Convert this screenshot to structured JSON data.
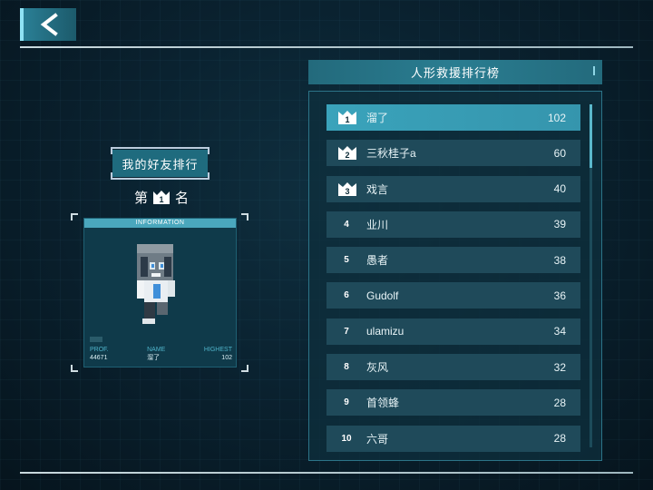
{
  "header": {
    "back_icon": "chevron-left-icon"
  },
  "friends": {
    "title": "我的好友排行",
    "rank_prefix": "第",
    "rank_value": "1",
    "rank_suffix": "名",
    "card": {
      "header": "INFORMATION",
      "prof_label": "PROF.",
      "prof_value": "44671",
      "name_label": "NAME",
      "name_value": "溜了",
      "highest_label": "HIGHEST",
      "highest_value": "102"
    }
  },
  "leaderboard": {
    "title": "人形救援排行榜",
    "rows": [
      {
        "rank": "1",
        "name": "溜了",
        "score": "102",
        "crown": true
      },
      {
        "rank": "2",
        "name": "三秋桂子a",
        "score": "60",
        "crown": true
      },
      {
        "rank": "3",
        "name": "戏言",
        "score": "40",
        "crown": true
      },
      {
        "rank": "4",
        "name": "业川",
        "score": "39",
        "crown": false
      },
      {
        "rank": "5",
        "name": "愚者",
        "score": "38",
        "crown": false
      },
      {
        "rank": "6",
        "name": "Gudolf",
        "score": "36",
        "crown": false
      },
      {
        "rank": "7",
        "name": "ulamizu",
        "score": "34",
        "crown": false
      },
      {
        "rank": "8",
        "name": "灰风",
        "score": "32",
        "crown": false
      },
      {
        "rank": "9",
        "name": "首领蜂",
        "score": "28",
        "crown": false
      },
      {
        "rank": "10",
        "name": "六哥",
        "score": "28",
        "crown": false
      }
    ]
  },
  "colors": {
    "accent": "#3aa3bb",
    "panel": "#1f4a5a",
    "background": "#0a2230"
  }
}
